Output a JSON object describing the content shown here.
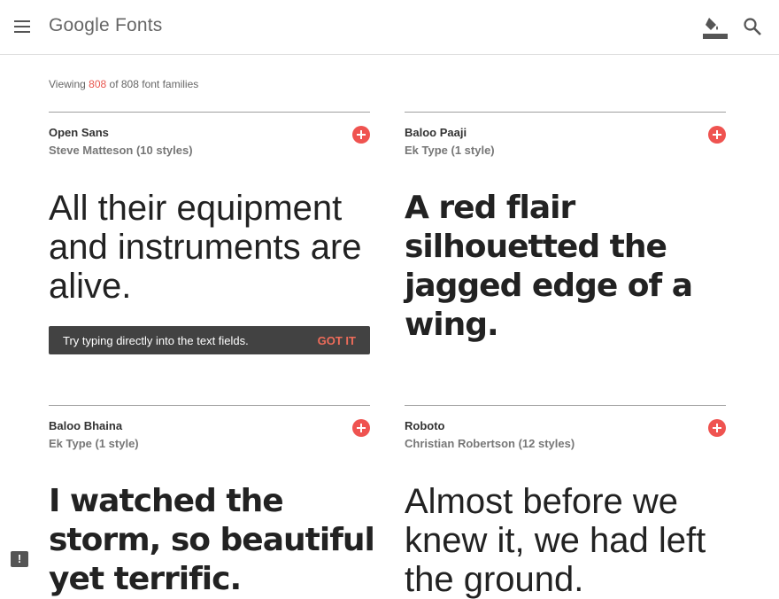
{
  "header": {
    "logo": "Google Fonts",
    "icons": [
      "menu-icon",
      "paint-bucket-icon",
      "search-icon"
    ]
  },
  "viewing": {
    "prefix": "Viewing",
    "count": "808",
    "suffix": "of 808 font families"
  },
  "cards": [
    {
      "name": "Open Sans",
      "designer": "Steve Matteson (10 styles)",
      "sample": "All their equipment and instruments are alive."
    },
    {
      "name": "Baloo Paaji",
      "designer": "Ek Type (1 style)",
      "sample": "A red flair silhouetted the jagged edge of a wing."
    },
    {
      "name": "Baloo Bhaina",
      "designer": "Ek Type (1 style)",
      "sample": "I watched the storm, so beautiful yet terrific."
    },
    {
      "name": "Roboto",
      "designer": "Christian Robertson (12 styles)",
      "sample": "Almost before we knew it, we had left the ground."
    }
  ],
  "tooltip": {
    "text": "Try typing directly into the text fields.",
    "action": "GOT IT"
  },
  "colors": {
    "accent": "#ef5350",
    "tooltip_bg": "#424242"
  }
}
